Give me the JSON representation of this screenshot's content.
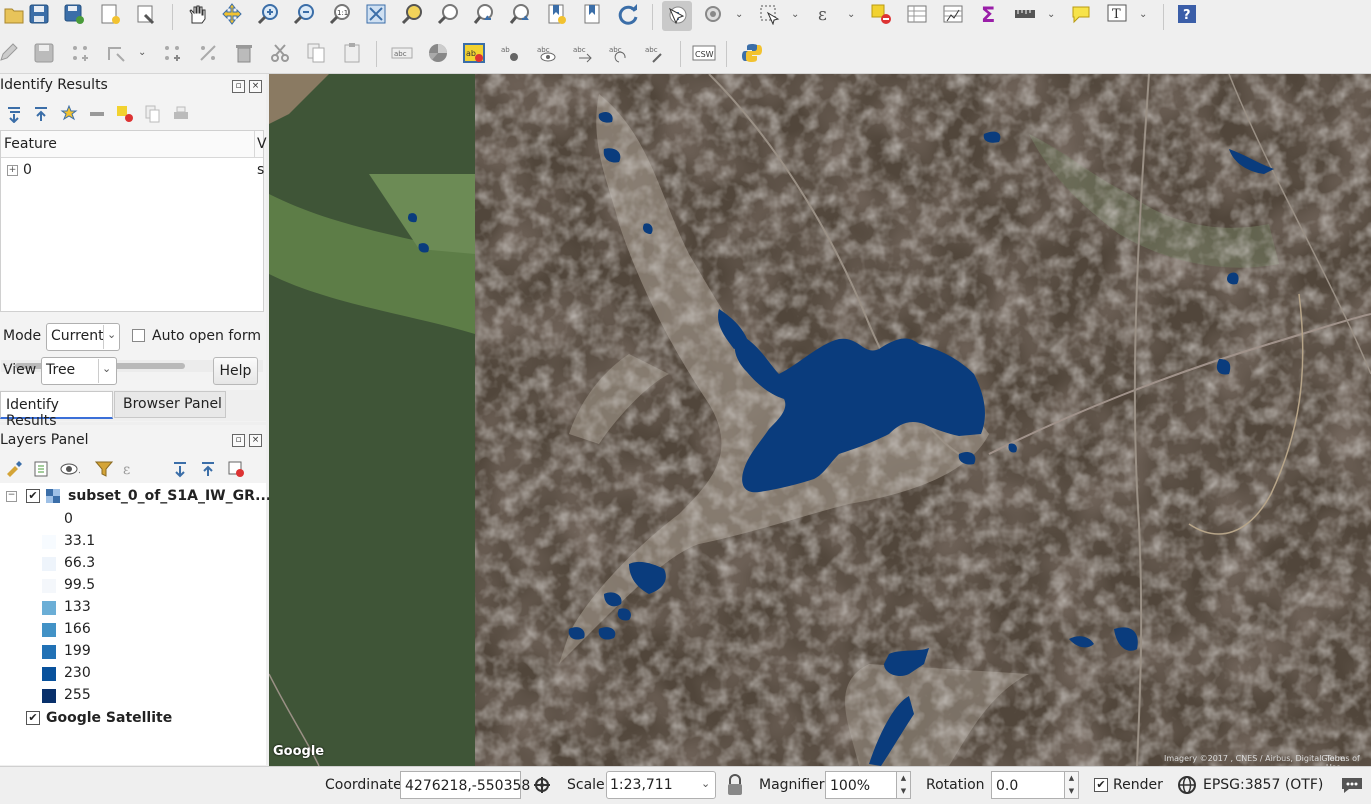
{
  "colors": {
    "water": "#0a3c7d",
    "legend_0": "#ffffff",
    "legend_33": "#f7fbff",
    "legend_66": "#eef4fb",
    "legend_99": "#f4f7fb",
    "legend_133": "#6baed6",
    "legend_166": "#4292c6",
    "legend_199": "#2171b5",
    "legend_230": "#08519c",
    "legend_255": "#08306b",
    "tab_active_border": "#3a6fd8"
  },
  "toolbar1": {
    "icons": [
      "save-project-icon",
      "save-as-icon",
      "new-print-layout-icon",
      "layout-manager-icon",
      "pan-icon",
      "pan-to-selection-icon",
      "zoom-in-icon",
      "zoom-out-icon",
      "zoom-native-icon",
      "zoom-full-icon",
      "zoom-to-selection-icon",
      "zoom-to-layer-icon",
      "zoom-last-icon",
      "zoom-next-icon",
      "new-bookmark-icon",
      "show-bookmarks-icon",
      "refresh-icon",
      "identify-icon",
      "measure-icon",
      "select-icon",
      "expression-select-icon",
      "deselect-icon",
      "attribute-table-icon",
      "field-calculator-icon",
      "statistics-icon",
      "measure-line-icon",
      "map-tips-icon",
      "text-annotation-icon",
      "help-icon"
    ]
  },
  "toolbar2": {
    "icons": [
      "digitize-pencil-icon",
      "save-edits-icon",
      "add-feature-icon",
      "vertex-tool-icon",
      "move-feature-icon",
      "node-tool-icon",
      "delete-selected-icon",
      "cut-features-icon",
      "copy-features-icon",
      "paste-features-icon",
      "label-tool-icon",
      "diagram-tool-icon",
      "highlight-labels-icon",
      "pin-labels-icon",
      "show-hide-labels-icon",
      "move-label-icon",
      "rotate-label-icon",
      "change-label-icon",
      "csw-icon",
      "python-console-icon"
    ],
    "csw_label": "CSW"
  },
  "identify": {
    "title": "Identify Results",
    "col_feature": "Feature",
    "col_value": "V",
    "row_id": "0",
    "row_value": "s",
    "mode_label": "Mode",
    "mode_value": "Current",
    "auto_open_label": "Auto open form",
    "view_label": "View",
    "view_value": "Tree",
    "help_label": "Help"
  },
  "tabs": {
    "identify_results": "Identify Results",
    "browser_panel": "Browser Panel"
  },
  "layers": {
    "title": "Layers Panel",
    "raster_layer": "subset_0_of_S1A_IW_GR...",
    "legend": [
      "0",
      "33.1",
      "66.3",
      "99.5",
      "133",
      "166",
      "199",
      "230",
      "255"
    ],
    "satellite_layer": "Google Satellite"
  },
  "map": {
    "google_logo": "Google",
    "attribution": "Imagery ©2017 , CNES / Airbus, DigitalGlobe",
    "terms": "Terms of Use"
  },
  "status": {
    "coordinate_label": "Coordinate",
    "coordinate_value": "4276218,-550358",
    "scale_label": "Scale",
    "scale_value": "1:23,711",
    "magnifier_label": "Magnifier",
    "magnifier_value": "100%",
    "rotation_label": "Rotation",
    "rotation_value": "0.0",
    "render_label": "Render",
    "crs_label": "EPSG:3857 (OTF)"
  }
}
